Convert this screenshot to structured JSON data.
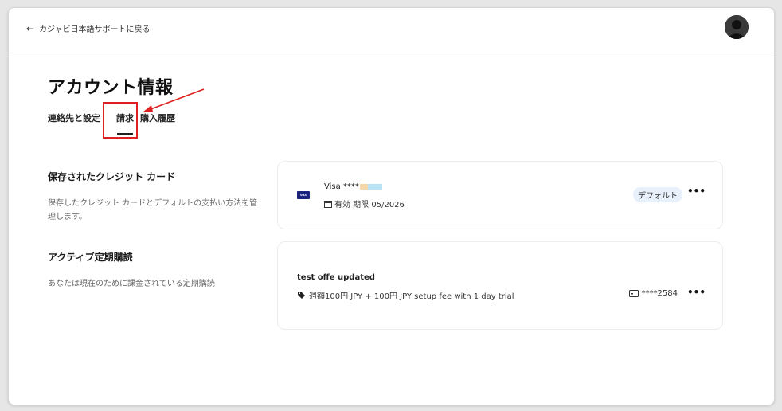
{
  "header": {
    "back_arrow": "←",
    "back_label": "カジャビ日本語サポートに戻る",
    "avatar_icon": "user-avatar"
  },
  "page": {
    "title": "アカウント情報"
  },
  "tabs": [
    {
      "label": "連絡先と設定",
      "active": false
    },
    {
      "label": "請求",
      "active": true
    },
    {
      "label": "購入履歴",
      "active": false
    }
  ],
  "annotation": {
    "color": "#e02020"
  },
  "credit_cards": {
    "title": "保存されたクレジット カード",
    "description": "保存したクレジット カードとデフォルトの支払い方法を管理します。",
    "card": {
      "brand_icon_text": "VISA",
      "label": "Visa ****",
      "expiry": "有効 期限 05/2026",
      "badge": "デフォルト",
      "more": "•••"
    }
  },
  "subscriptions": {
    "title": "アクティブ定期購読",
    "description": "あなたは現在のために課金されている定期購読",
    "item": {
      "name": "test offe updated",
      "price": "週額100円 JPY + 100円 JPY setup fee with 1 day trial",
      "card": "****2584",
      "more": "•••"
    }
  },
  "colors": {
    "visa": "#1a237e",
    "badge_bg": "#e8f1fb",
    "annotation_red": "#e02020"
  }
}
